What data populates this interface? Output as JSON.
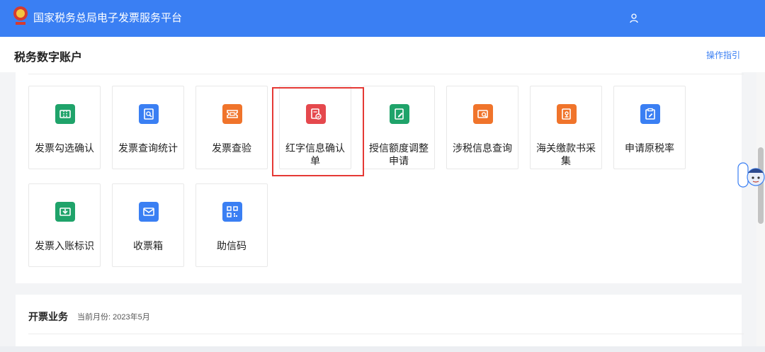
{
  "header": {
    "app_title": "国家税务总局电子发票服务平台",
    "brand_color": "#3a7ff3",
    "logo_icon": "tax-emblem-icon",
    "user_icon": "user-icon"
  },
  "subheader": {
    "page_title": "税务数字账户",
    "guide_link": "操作指引"
  },
  "tiles": [
    {
      "label": "发票勾选确认",
      "icon": "ticket-check-icon",
      "color": "#1fa36a"
    },
    {
      "label": "发票查询统计",
      "icon": "document-search-icon",
      "color": "#3a7ff3"
    },
    {
      "label": "发票查验",
      "icon": "ticket-verify-icon",
      "color": "#f0742b"
    },
    {
      "label": "红字信息确认单",
      "icon": "red-letter-confirm-icon",
      "color": "#e5484d",
      "highlighted": true
    },
    {
      "label": "授信额度调整申请",
      "icon": "credit-edit-icon",
      "color": "#1fa36a"
    },
    {
      "label": "涉税信息查询",
      "icon": "tax-info-search-icon",
      "color": "#f0742b"
    },
    {
      "label": "海关缴款书采集",
      "icon": "customs-payment-icon",
      "color": "#f0742b"
    },
    {
      "label": "申请原税率",
      "icon": "clipboard-edit-icon",
      "color": "#3a7ff3"
    },
    {
      "label": "发票入账标识",
      "icon": "ticket-inbox-icon",
      "color": "#1fa36a"
    },
    {
      "label": "收票箱",
      "icon": "mail-icon",
      "color": "#3a7ff3"
    },
    {
      "label": "助信码",
      "icon": "qr-code-icon",
      "color": "#3a7ff3"
    }
  ],
  "section": {
    "title": "开票业务",
    "month_label": "当前月份: 2023年5月"
  },
  "assistant": {
    "icon": "assistant-avatar-icon"
  }
}
